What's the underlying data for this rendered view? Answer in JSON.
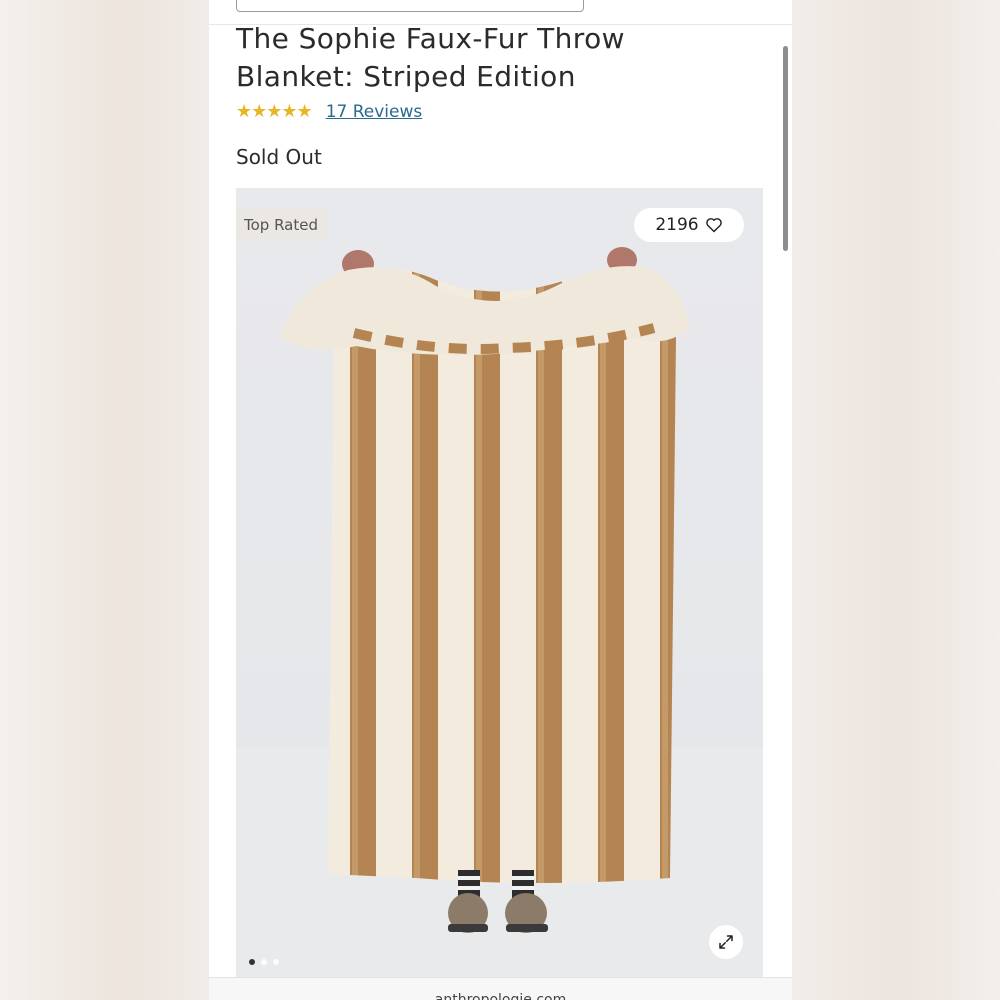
{
  "product": {
    "title_line1": "The Sophie Faux-Fur Throw",
    "title_line2": "Blanket: Striped Edition",
    "stars": "★★★★★",
    "reviews_link": "17 Reviews",
    "stock_status": "Sold Out"
  },
  "gallery": {
    "badge": "Top Rated",
    "like_count": "2196",
    "slide_count": 3,
    "active_slide": 1
  },
  "browser": {
    "url": "anthropologie.com"
  },
  "colors": {
    "star": "#e8b523",
    "link": "#2a6a8c",
    "stripe_tan": "#b98b56",
    "stripe_cream": "#f5ede0"
  }
}
